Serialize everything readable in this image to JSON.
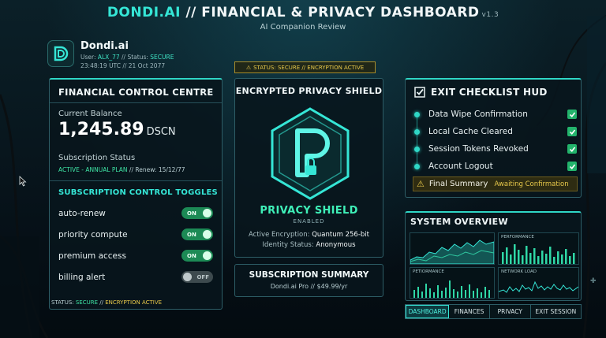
{
  "header": {
    "brand": "DONDI.AI",
    "title_rest": " // FINANCIAL & PRIVACY DASHBOARD",
    "version": "v1.3",
    "subtitle": "AI Companion Review"
  },
  "user": {
    "name": "Dondi.ai",
    "user_label": "User: ",
    "user_id": "ALX_77",
    "status_label": " // Status: ",
    "status_value": "SECURE",
    "datetime": "23:48:19 UTC // 21 Oct 2077"
  },
  "top_status": "STATUS: SECURE // ENCRYPTION ACTIVE",
  "financial": {
    "title": "FINANCIAL CONTROL CENTRE",
    "balance_label": "Current Balance",
    "balance_value": "1,245.89",
    "balance_unit": "DSCN",
    "subscription_label": "Subscription Status",
    "subscription_value": "ACTIVE - ANNUAL PLAN",
    "renew_text": " // Renew: 15/12/77",
    "toggles_header": "SUBSCRIPTION CONTROL TOGGLES",
    "toggles": [
      {
        "label": "auto-renew",
        "state": "ON"
      },
      {
        "label": "priority compute",
        "state": "ON"
      },
      {
        "label": "premium access",
        "state": "ON"
      },
      {
        "label": "billing alert",
        "state": "OFF"
      }
    ],
    "footer_prefix": "STATUS: ",
    "footer_secure": "SECURE",
    "footer_sep": " // ",
    "footer_enc": "ENCRYPTION ACTIVE"
  },
  "privacy": {
    "title": "ENCRYPTED PRIVACY SHIELD",
    "shield_title": "PRIVACY SHIELD",
    "shield_state": "ENABLED",
    "encryption_label": "Active Encryption: ",
    "encryption_value": "Quantum 256-bit",
    "identity_label": "Identity Status: ",
    "identity_value": "Anonymous"
  },
  "subscription_summary": {
    "title": "SUBSCRIPTION SUMMARY",
    "detail": "Dondi.ai Pro // $49.99/yr"
  },
  "checklist": {
    "title": "EXIT CHECKLIST HUD",
    "items": [
      {
        "label": "Data Wipe Confirmation",
        "done": true
      },
      {
        "label": "Local Cache Cleared",
        "done": true
      },
      {
        "label": "Session Tokens Revoked",
        "done": true
      },
      {
        "label": "Account Logout",
        "done": true
      }
    ],
    "final_label": "Final Summary",
    "final_status": "Awaiting Confirmation"
  },
  "system": {
    "title": "SYSTEM OVERVIEW",
    "charts": [
      {
        "label": ""
      },
      {
        "label": "PERFORMANCE"
      },
      {
        "label": "PETIORMANCE"
      },
      {
        "label": "NETWORK LOAD"
      }
    ]
  },
  "tabs": [
    {
      "label": "DASHBOARD",
      "active": true
    },
    {
      "label": "FINANCES",
      "active": false
    },
    {
      "label": "PRIVACY",
      "active": false
    },
    {
      "label": "EXIT SESSION",
      "active": false
    }
  ],
  "colors": {
    "accent": "#35e6d6",
    "good": "#3fe3a4",
    "warn": "#e7c84a",
    "bg": "#07141a"
  }
}
